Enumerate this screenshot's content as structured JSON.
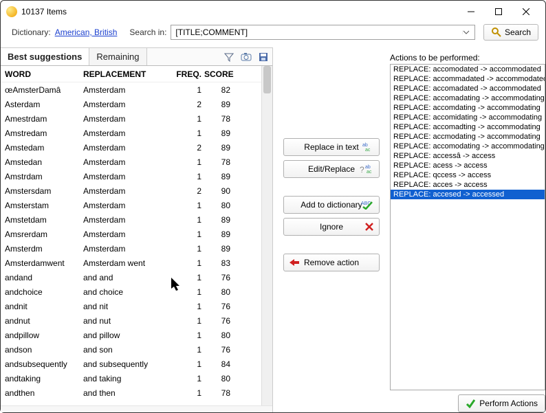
{
  "window": {
    "title": "10137 Items"
  },
  "toolbar": {
    "dict_label": "Dictionary:",
    "dict_value": "American, British",
    "searchin_label": "Search in:",
    "searchin_value": "[TITLE;COMMENT]",
    "search_label": "Search"
  },
  "tabs": {
    "best": "Best suggestions",
    "remaining": "Remaining"
  },
  "grid": {
    "headers": {
      "word": "WORD",
      "replacement": "REPLACEMENT",
      "freq": "FREQ.",
      "score": "SCORE"
    },
    "rows": [
      {
        "word": "œAmsterDamâ",
        "repl": "Amsterdam",
        "freq": 1,
        "score": 82
      },
      {
        "word": "Asterdam",
        "repl": "Amsterdam",
        "freq": 2,
        "score": 89
      },
      {
        "word": "Amestrdam",
        "repl": "Amsterdam",
        "freq": 1,
        "score": 78
      },
      {
        "word": "Amstredam",
        "repl": "Amsterdam",
        "freq": 1,
        "score": 89
      },
      {
        "word": "Amstedam",
        "repl": "Amsterdam",
        "freq": 2,
        "score": 89
      },
      {
        "word": "Amstedan",
        "repl": "Amsterdam",
        "freq": 1,
        "score": 78
      },
      {
        "word": "Amstrdam",
        "repl": "Amsterdam",
        "freq": 1,
        "score": 89
      },
      {
        "word": "Amstersdam",
        "repl": "Amsterdam",
        "freq": 2,
        "score": 90
      },
      {
        "word": "Amsterstam",
        "repl": "Amsterdam",
        "freq": 1,
        "score": 80
      },
      {
        "word": "Amstetdam",
        "repl": "Amsterdam",
        "freq": 1,
        "score": 89
      },
      {
        "word": "Amsrerdam",
        "repl": "Amsterdam",
        "freq": 1,
        "score": 89
      },
      {
        "word": "Amsterdm",
        "repl": "Amsterdam",
        "freq": 1,
        "score": 89
      },
      {
        "word": "Amsterdamwent",
        "repl": "Amsterdam went",
        "freq": 1,
        "score": 83
      },
      {
        "word": "andand",
        "repl": "and and",
        "freq": 1,
        "score": 76
      },
      {
        "word": "andchoice",
        "repl": "and choice",
        "freq": 1,
        "score": 80
      },
      {
        "word": "andnit",
        "repl": "and nit",
        "freq": 1,
        "score": 76
      },
      {
        "word": "andnut",
        "repl": "and nut",
        "freq": 1,
        "score": 76
      },
      {
        "word": "andpillow",
        "repl": "and pillow",
        "freq": 1,
        "score": 80
      },
      {
        "word": "andson",
        "repl": "and son",
        "freq": 1,
        "score": 76
      },
      {
        "word": "andsubsequently",
        "repl": "and subsequently",
        "freq": 1,
        "score": 84
      },
      {
        "word": "andtaking",
        "repl": "and taking",
        "freq": 1,
        "score": 80
      },
      {
        "word": "andthen",
        "repl": "and then",
        "freq": 1,
        "score": 78
      }
    ]
  },
  "buttons": {
    "replace_in_text": "Replace in text",
    "edit_replace": "Edit/Replace",
    "add_to_dict": "Add to dictionary",
    "ignore": "Ignore",
    "remove_action": "Remove action",
    "perform_actions": "Perform Actions"
  },
  "actions": {
    "label": "Actions to be performed:",
    "items": [
      {
        "text": "REPLACE: accomodated -> accommodated",
        "selected": false
      },
      {
        "text": "REPLACE: accommadated -> accommodated",
        "selected": false
      },
      {
        "text": "REPLACE: accomadated -> accommodated",
        "selected": false
      },
      {
        "text": "REPLACE: accomadating -> accommodating",
        "selected": false
      },
      {
        "text": "REPLACE: accomdating -> accommodating",
        "selected": false
      },
      {
        "text": "REPLACE: accomidating -> accommodating",
        "selected": false
      },
      {
        "text": "REPLACE: accomadting -> accommodating",
        "selected": false
      },
      {
        "text": "REPLACE: accmodating -> accommodating",
        "selected": false
      },
      {
        "text": "REPLACE: accomodating -> accommodating",
        "selected": false
      },
      {
        "text": "REPLACE: accessâ -> access",
        "selected": false
      },
      {
        "text": "REPLACE: acess -> access",
        "selected": false
      },
      {
        "text": "REPLACE: qccess -> access",
        "selected": false
      },
      {
        "text": "REPLACE: acces -> access",
        "selected": false
      },
      {
        "text": "REPLACE: accesed -> accessed",
        "selected": true
      }
    ]
  }
}
